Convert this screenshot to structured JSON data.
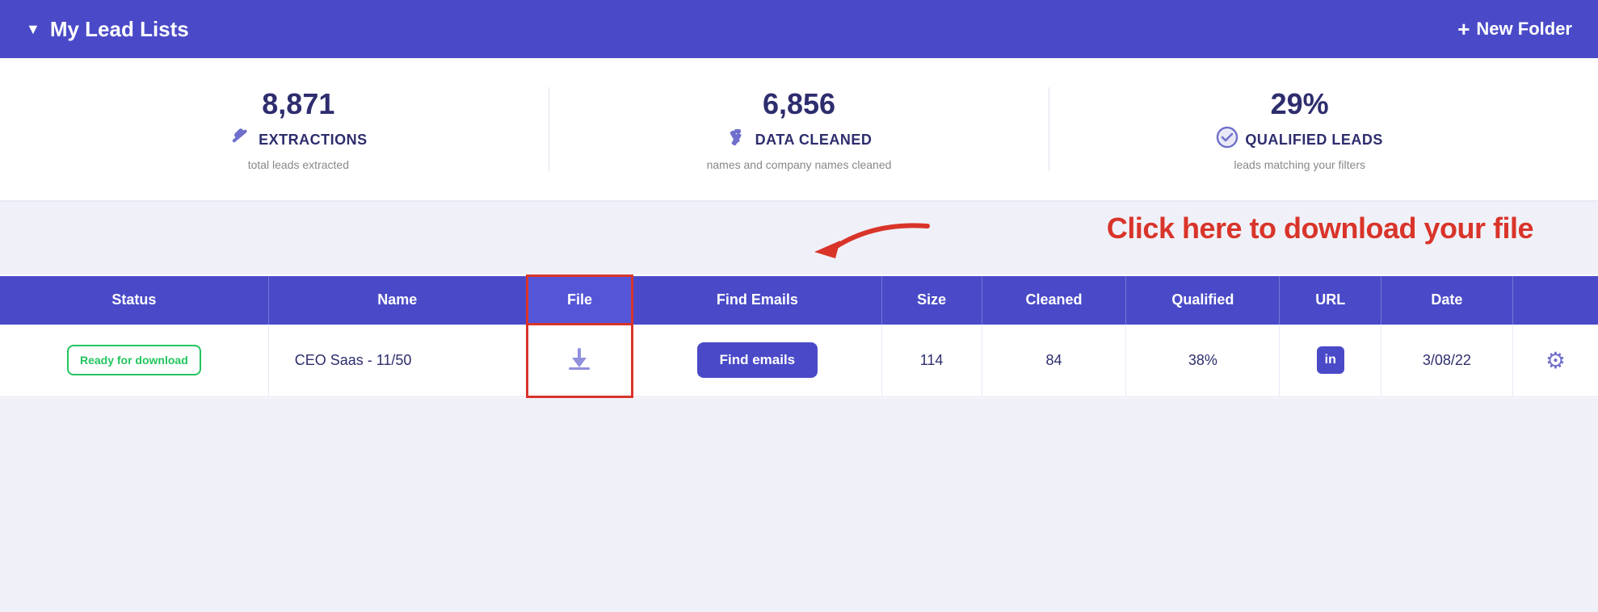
{
  "header": {
    "chevron": "▼",
    "title": "My Lead Lists",
    "new_folder_label": "New Folder",
    "plus_symbol": "+"
  },
  "stats": [
    {
      "number": "8,871",
      "icon": "🔨",
      "label": "EXTRACTIONS",
      "sub": "total leads extracted"
    },
    {
      "number": "6,856",
      "icon": "✂️",
      "label": "DATA CLEANED",
      "sub": "names and company names cleaned"
    },
    {
      "number": "29%",
      "icon": "✔",
      "label": "QUALIFIED LEADS",
      "sub": "leads matching your filters"
    }
  ],
  "annotation": {
    "text": "Click here to download your file"
  },
  "table": {
    "columns": [
      "Status",
      "Name",
      "File",
      "Find Emails",
      "Size",
      "Cleaned",
      "Qualified",
      "URL",
      "Date",
      ""
    ],
    "rows": [
      {
        "status": "Ready for\ndownload",
        "name": "CEO Saas - 11/50",
        "file": "download",
        "find_emails": "Find emails",
        "size": "114",
        "cleaned": "84",
        "qualified": "38%",
        "url": "in",
        "date": "3/08/22",
        "actions": "gear"
      }
    ]
  }
}
